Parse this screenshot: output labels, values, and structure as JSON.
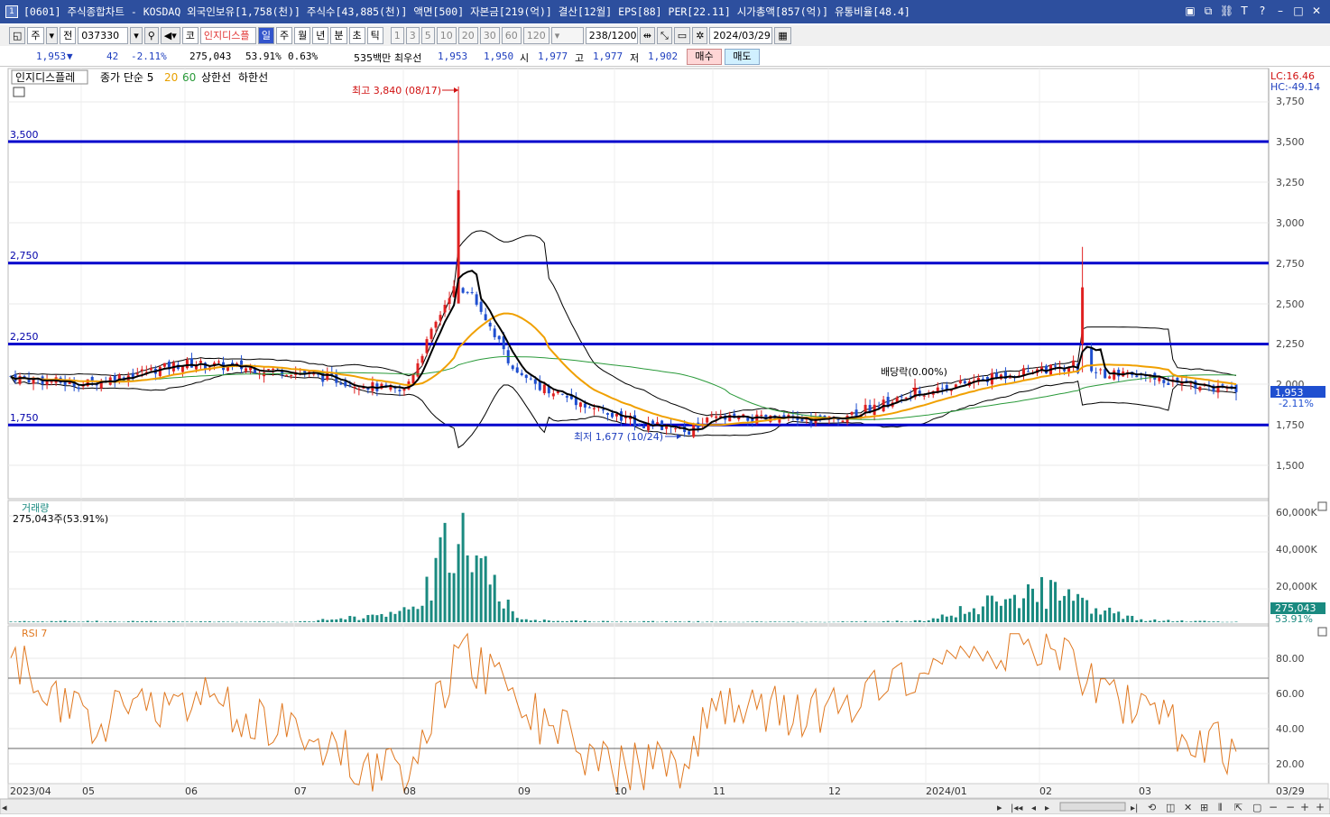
{
  "window": {
    "title": "[0601] 주식종합차트 - KOSDAQ 외국인보유[1,758(천)] 주식수[43,885(천)] 액면[500] 자본금[219(억)] 결산[12월] EPS[88] PER[22.11] 시가총액[857(억)] 유통비율[48.4]",
    "num": "1"
  },
  "toolbar": {
    "type_label": "주",
    "prev_label": "전",
    "code": "037330",
    "market_label": "코",
    "stock_name": "인지디스플",
    "periods": [
      "일",
      "주",
      "월",
      "년",
      "분",
      "초",
      "틱"
    ],
    "active_period": "일",
    "intervals": [
      "1",
      "3",
      "5",
      "10",
      "20",
      "30",
      "60",
      "120"
    ],
    "count": "238/1200",
    "date": "2024/03/29"
  },
  "quote": {
    "price": "1,953",
    "arrow": "▼",
    "change": "42",
    "change_pct": "-2.11%",
    "volume": "275,043",
    "vol_ratio": "53.91%",
    "turnover": "0.63%",
    "amount": "535백만",
    "prefer_label": "최우선",
    "best1": "1,953",
    "best2": "1,950",
    "open_label": "시",
    "open": "1,977",
    "high_label": "고",
    "high": "1,977",
    "low_label": "저",
    "low": "1,902",
    "buy": "매수",
    "sell": "매도"
  },
  "legend": {
    "name": "인지디스플레",
    "ma_prefix": "종가 단순 5",
    "ma20": "20",
    "ma60": "60",
    "upper": "상한선",
    "lower": "하한선"
  },
  "price_axis": {
    "ticks": [
      "3,750",
      "3,500",
      "3,250",
      "3,000",
      "2,750",
      "2,500",
      "2,250",
      "2,000",
      "1,750",
      "1,500"
    ],
    "lc": "LC:16.46",
    "hc": "HC:-49.14",
    "current": "1,953",
    "current_pct": "-2.11%"
  },
  "hlines": [
    "3,500",
    "2,750",
    "2,250",
    "1,750"
  ],
  "annotations": {
    "high": "최고 3,840 (08/17)",
    "low": "최저 1,677 (10/24)",
    "dividend": "배당락(0.00%)"
  },
  "volume_panel": {
    "title": "거래량",
    "info": "275,043주(53.91%)",
    "ticks": [
      "60,000K",
      "40,000K",
      "20,000K"
    ],
    "current": "275,043",
    "current_pct": "53.91%"
  },
  "rsi_panel": {
    "title": "RSI 7",
    "ticks": [
      "80.00",
      "60.00",
      "40.00",
      "20.00"
    ]
  },
  "date_axis": [
    "2023/04",
    "05",
    "06",
    "07",
    "08",
    "09",
    "10",
    "11",
    "12",
    "2024/01",
    "02",
    "03",
    "03/29"
  ],
  "colors": {
    "up": "#e02020",
    "down": "#1f4fd0",
    "ma5": "#000000",
    "ma20": "#f0a000",
    "ma60": "#2a9a3a",
    "band": "#000000",
    "hline": "#0000cc",
    "volume": "#1a8a80",
    "rsi": "#e07820"
  },
  "chart_data": {
    "type": "candlestick",
    "x": [
      "2023/04",
      "05",
      "06",
      "07",
      "08",
      "08/17",
      "09",
      "10",
      "10/24",
      "11",
      "12",
      "2024/01",
      "02",
      "03",
      "03/29"
    ],
    "close": [
      2050,
      2000,
      2130,
      2080,
      1950,
      2700,
      2050,
      1800,
      1700,
      1790,
      1780,
      1960,
      2100,
      2050,
      1953
    ],
    "high": [
      2340,
      2210,
      2220,
      2200,
      2650,
      3840,
      2300,
      2000,
      1800,
      1850,
      1840,
      2180,
      2850,
      2150,
      1977
    ],
    "low": [
      1850,
      1900,
      2000,
      1950,
      1700,
      1960,
      1950,
      1700,
      1677,
      1720,
      1740,
      1800,
      1780,
      1920,
      1902
    ],
    "volume_k": [
      500,
      800,
      500,
      300,
      6000,
      60000,
      1500,
      500,
      600,
      400,
      300,
      1000,
      22000,
      1500,
      275
    ],
    "rsi": [
      82,
      45,
      60,
      40,
      12,
      88,
      55,
      18,
      22,
      55,
      50,
      80,
      92,
      50,
      28
    ],
    "ylim": [
      1400,
      3800
    ]
  }
}
